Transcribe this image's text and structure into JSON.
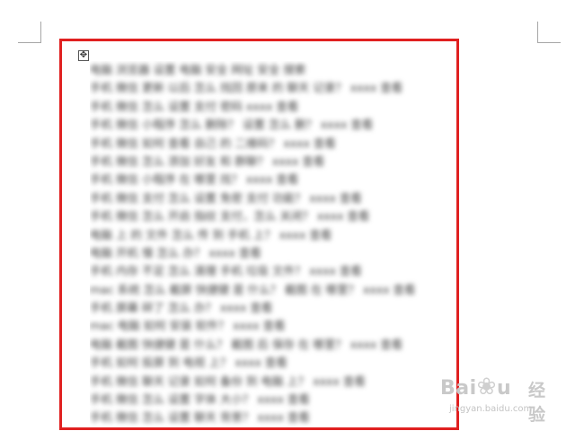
{
  "document": {
    "lines": [
      "电脑 浏览器 设置 电脑 安全 网址 安全 搜索",
      "手机 微信 更新 以后 怎么 找回 原来 的 聊天 记录？ xxxx 查看",
      "手机 微信 怎么 设置 支付 密码 xxxx 查看",
      "手机 微信 小程序 怎么 删除？ 设置 怎么 删？ xxxx 查看",
      "手机 微信 如何 查看 自己 的 二维码？ xxxx 查看",
      "手机 微信 怎么 添加 好友 和 群聊？ xxxx 查看",
      "手机 微信 小程序 在 哪里 找？ xxxx 查看",
      "手机 微信 支付 怎么 设置 免密 支付 功能？ xxxx 查看",
      "手机 微信 怎么 开启 指纹 支付，怎么 关闭？ xxxx 查看",
      "电脑 上 的 文件 怎么 传 到 手机 上？ xxxx 查看",
      "电脑 开机 慢 怎么 办？ xxxx 查看",
      "手机 内存 不足 怎么 清理 手机 垃圾 文件？ xxxx 查看",
      "mac 系统 怎么 截屏 快捷键 是 什么？ 截图 在 哪里？ xxxx 查看",
      "手机 屏幕 碎了 怎么 办？ xxxx 查看",
      "mac 电脑 如何 安装 软件？ xxxx 查看",
      "电脑 截图 快捷键 是 什么？ 截图 后 保存 在 哪里？ xxxx 查看",
      "手机 如何 投屏 到 电视 上？ xxxx 查看",
      "手机 微信 聊天 记录 如何 备份 到 电脑 上？ xxxx 查看",
      "手机 微信 怎么 设置 字体 大小？ xxxx 查看",
      "手机 微信 怎么 设置 聊天 背景？ xxxx 查看"
    ],
    "move_handle_glyph": "✥"
  },
  "watermark": {
    "logo": "Bai",
    "paw": "❀",
    "logo_tail": "u",
    "jingyan": "经验",
    "url": "jingyan.baidu.com"
  },
  "colors": {
    "selection_border": "#e02020",
    "text": "#3a3a3a",
    "watermark": "#c9c9c9"
  }
}
